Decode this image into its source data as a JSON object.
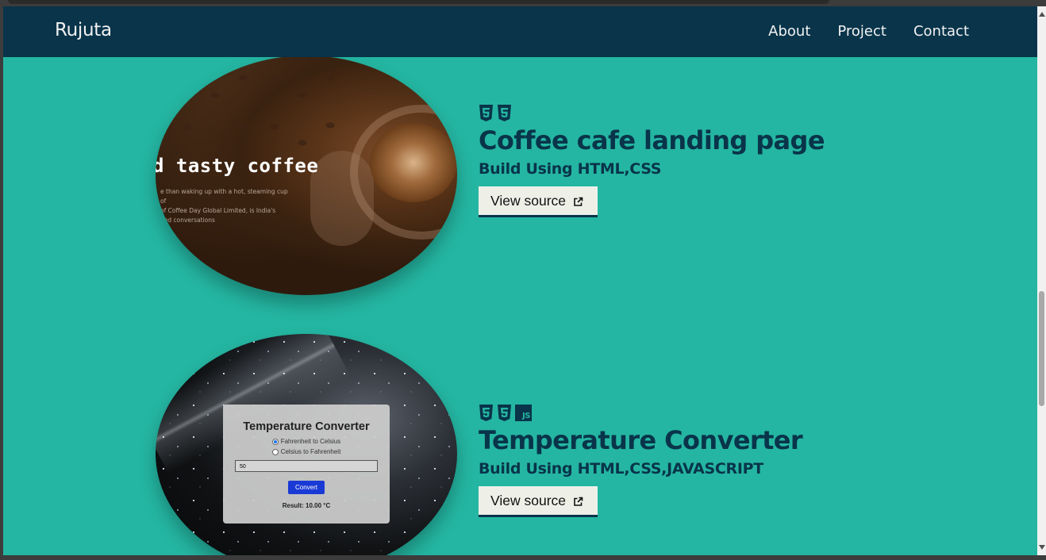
{
  "navbar": {
    "brand": "Rujuta",
    "links": [
      "About",
      "Project",
      "Contact"
    ]
  },
  "projects": [
    {
      "title": "Coffee cafe landing page",
      "subtitle": "Build Using HTML,CSS",
      "button_label": "View source",
      "tech_icons": [
        "html5-icon",
        "css3-icon"
      ],
      "thumbnail": {
        "heading": "d tasty coffee",
        "copy_lines": [
          "e than waking up with a hot, steaming cup of",
          "of Coffee Day Global Limited, is India's",
          "and conversations"
        ]
      }
    },
    {
      "title": "Temperature Converter",
      "subtitle": "Build Using HTML,CSS,JAVASCRIPT",
      "button_label": "View source",
      "tech_icons": [
        "html5-icon",
        "css3-icon",
        "javascript-icon"
      ],
      "thumbnail": {
        "card_title": "Temperature Converter",
        "option_1": "Fahrenheit to Celsius",
        "option_2": "Celsius to Fahrenheit",
        "input_value": "50",
        "button": "Convert",
        "result": "Result: 10.00 °C"
      }
    }
  ],
  "js_badge_text": "JS",
  "colors": {
    "navbar": "#09344a",
    "background": "#24b6a2",
    "heading": "#09344a",
    "button_bg": "#eef0e8"
  }
}
